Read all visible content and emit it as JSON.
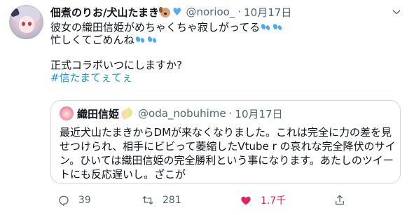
{
  "author": {
    "display_name": "佃煮のりお/犬山たまき",
    "emoji_dog": "dog-face-icon",
    "emoji_heart": "blue-heart-icon",
    "handle": "@norioo_",
    "separator": "·",
    "date": "10月17日"
  },
  "tweet": {
    "lines": [
      "彼女の織田信姫がめちゃくちゃ寂しがってる",
      "忙しくてごめんね",
      "",
      "正式コラボいつにしますか?"
    ],
    "hashtag": "#信たまてぇてぇ"
  },
  "quoted": {
    "display_name": "織田信姫",
    "handle": "@oda_nobuhime",
    "separator": "·",
    "date": "10月17日",
    "lines": [
      "最近犬山たまきからDMが来なくなりました。これは完全に力の差を見",
      "せつけられ、相手にビビって萎縮したVtube r の哀れな完全降伏のサイ",
      "ン。ひいては織田信姫の完全勝利という事になります。あたしのツイー",
      "トにも反応遅いし。ざこが"
    ]
  },
  "actions": {
    "reply_count": "39",
    "retweet_count": "281",
    "like_count": "1.7千"
  },
  "colors": {
    "like": "#e0245e",
    "link": "#1b95e0",
    "muted": "#536471",
    "border": "#cfd9de"
  }
}
